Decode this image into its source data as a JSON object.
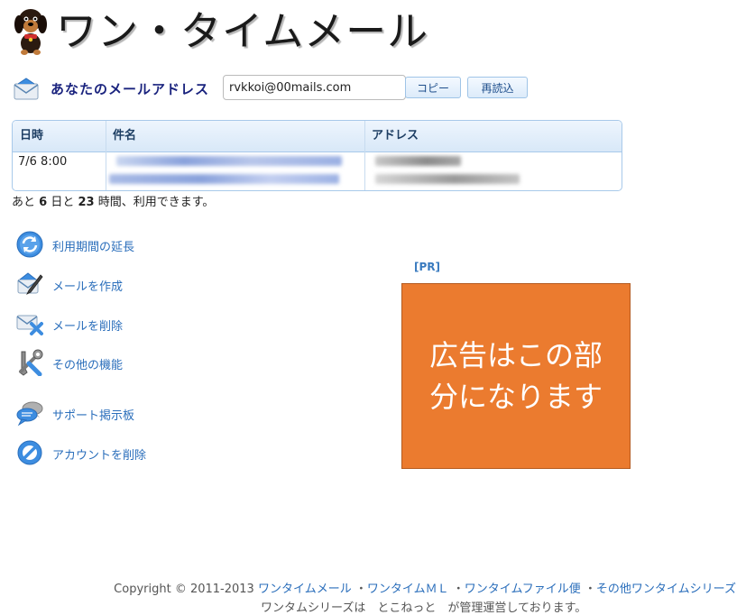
{
  "app": {
    "title": "ワン・タイムメール"
  },
  "address": {
    "label": "あなたのメールアドレス",
    "value": "rvkkoi@00mails.com",
    "copy_button": "コピー",
    "reload_button": "再読込"
  },
  "table": {
    "headers": [
      "日時",
      "件名",
      "アドレス"
    ],
    "rows": [
      {
        "datetime": "7/6 8:00"
      }
    ]
  },
  "remaining": {
    "prefix": "あと",
    "days": "6",
    "days_unit": "日と",
    "hours": "23",
    "suffix": "時間、利用できます。"
  },
  "menu": [
    {
      "label": "利用期間の延長",
      "icon": "refresh-icon"
    },
    {
      "label": "メールを作成",
      "icon": "compose-icon"
    },
    {
      "label": "メールを削除",
      "icon": "delete-mail-icon"
    },
    {
      "label": "その他の機能",
      "icon": "tools-icon"
    },
    {
      "label": "サポート掲示板",
      "icon": "chat-icon"
    },
    {
      "label": "アカウントを削除",
      "icon": "prohibit-icon"
    }
  ],
  "ad": {
    "tag": "[PR]",
    "text": "広告はこの部\n分になります",
    "color": "#eb7b2f"
  },
  "footer": {
    "copyright": "Copyright © 2011-2013",
    "links": [
      "ワンタイムメール",
      "ワンタイムＭＬ",
      "ワンタイムファイル便",
      "その他ワンタイムシリーズ"
    ],
    "line2": "ワンタムシリーズは　とこねっと　が管理運営しております。"
  }
}
